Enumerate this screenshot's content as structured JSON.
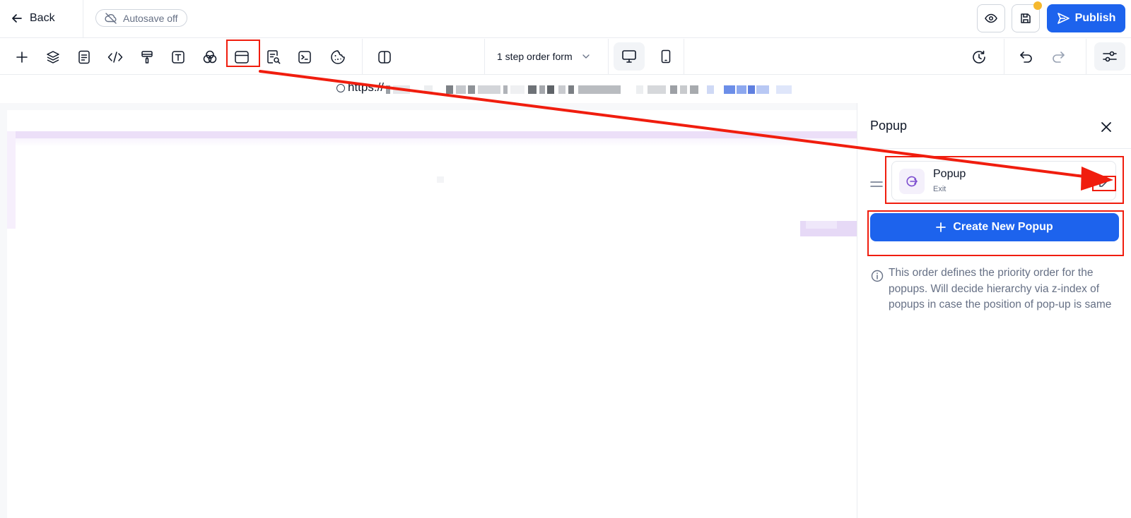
{
  "header": {
    "back_label": "Back",
    "autosave_label": "Autosave off",
    "publish_label": "Publish"
  },
  "toolbar": {
    "tools": [
      "add-icon",
      "layers-icon",
      "page-icon",
      "code-icon",
      "paint-roller-icon",
      "text-icon",
      "color-circles-icon",
      "popup-icon",
      "search-page-icon",
      "terminal-icon",
      "cookie-icon",
      "split-view-icon"
    ],
    "form_select_value": "1 step order form",
    "history_icon": "history-icon",
    "undo_icon": "undo-icon",
    "redo_icon": "redo-icon",
    "settings_icon": "sliders-icon"
  },
  "urlbar": {
    "url_prefix": "https://"
  },
  "panel": {
    "title": "Popup",
    "popup_item": {
      "name": "Popup",
      "trigger": "Exit"
    },
    "create_button_label": "Create New Popup",
    "info_text": "This order defines the priority order for the popups. Will decide hierarchy via z-index of popups in case the position of pop-up is same"
  },
  "colors": {
    "primary": "#1d63ed",
    "annotation_red": "#f01d0e",
    "notification_dot": "#f5b82e",
    "popup_icon_purple": "#7c4dcf"
  }
}
